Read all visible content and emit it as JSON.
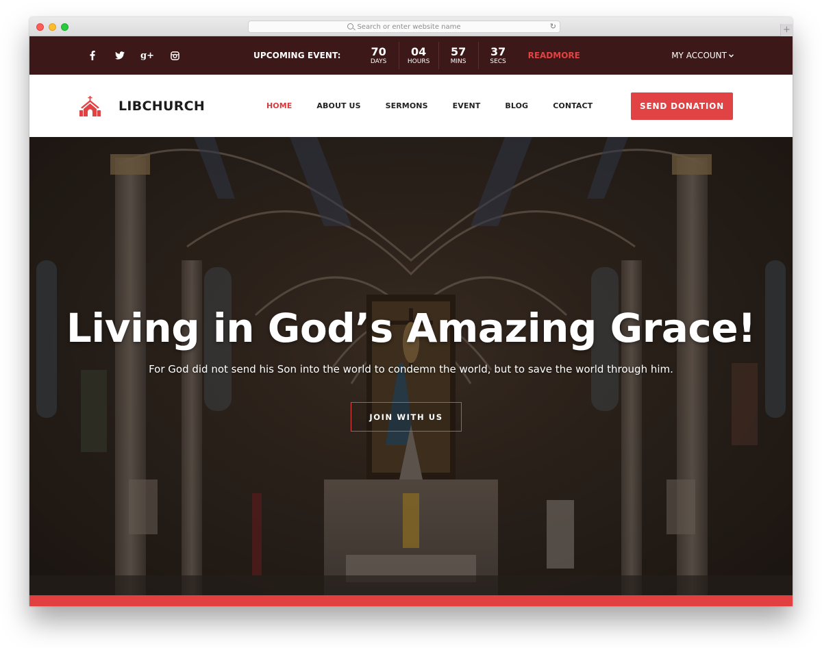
{
  "browser": {
    "url_placeholder": "Search or enter website name",
    "reload_icon": "↻",
    "new_tab_icon": "+"
  },
  "topbar": {
    "social": [
      {
        "name": "facebook-icon"
      },
      {
        "name": "twitter-icon"
      },
      {
        "name": "google-plus-icon",
        "glyph": "g+"
      },
      {
        "name": "instagram-icon"
      }
    ],
    "upcoming_label": "UPCOMING EVENT:",
    "countdown": [
      {
        "value": "70",
        "unit": "DAYS"
      },
      {
        "value": "04",
        "unit": "HOURS"
      },
      {
        "value": "57",
        "unit": "MINS"
      },
      {
        "value": "37",
        "unit": "SECS"
      }
    ],
    "readmore_label": "READMORE",
    "account_label": "MY ACCOUNT",
    "account_chevron": "⌄"
  },
  "header": {
    "logo_text": "LIBCHURCH",
    "nav": [
      {
        "label": "HOME",
        "active": true
      },
      {
        "label": "ABOUT US",
        "active": false
      },
      {
        "label": "SERMONS",
        "active": false
      },
      {
        "label": "EVENT",
        "active": false
      },
      {
        "label": "BLOG",
        "active": false
      },
      {
        "label": "CONTACT",
        "active": false
      }
    ],
    "donate_label": "SEND DONATION"
  },
  "hero": {
    "title": "Living in God’s Amazing Grace!",
    "subtitle": "For God did not send his Son into the world to condemn the world, but to save the world through him.",
    "cta_label": "JOIN WITH US"
  },
  "colors": {
    "topbar_bg": "#3d1818",
    "accent": "#e14344",
    "nav_active": "#d9393d",
    "text_dark": "#222222"
  }
}
